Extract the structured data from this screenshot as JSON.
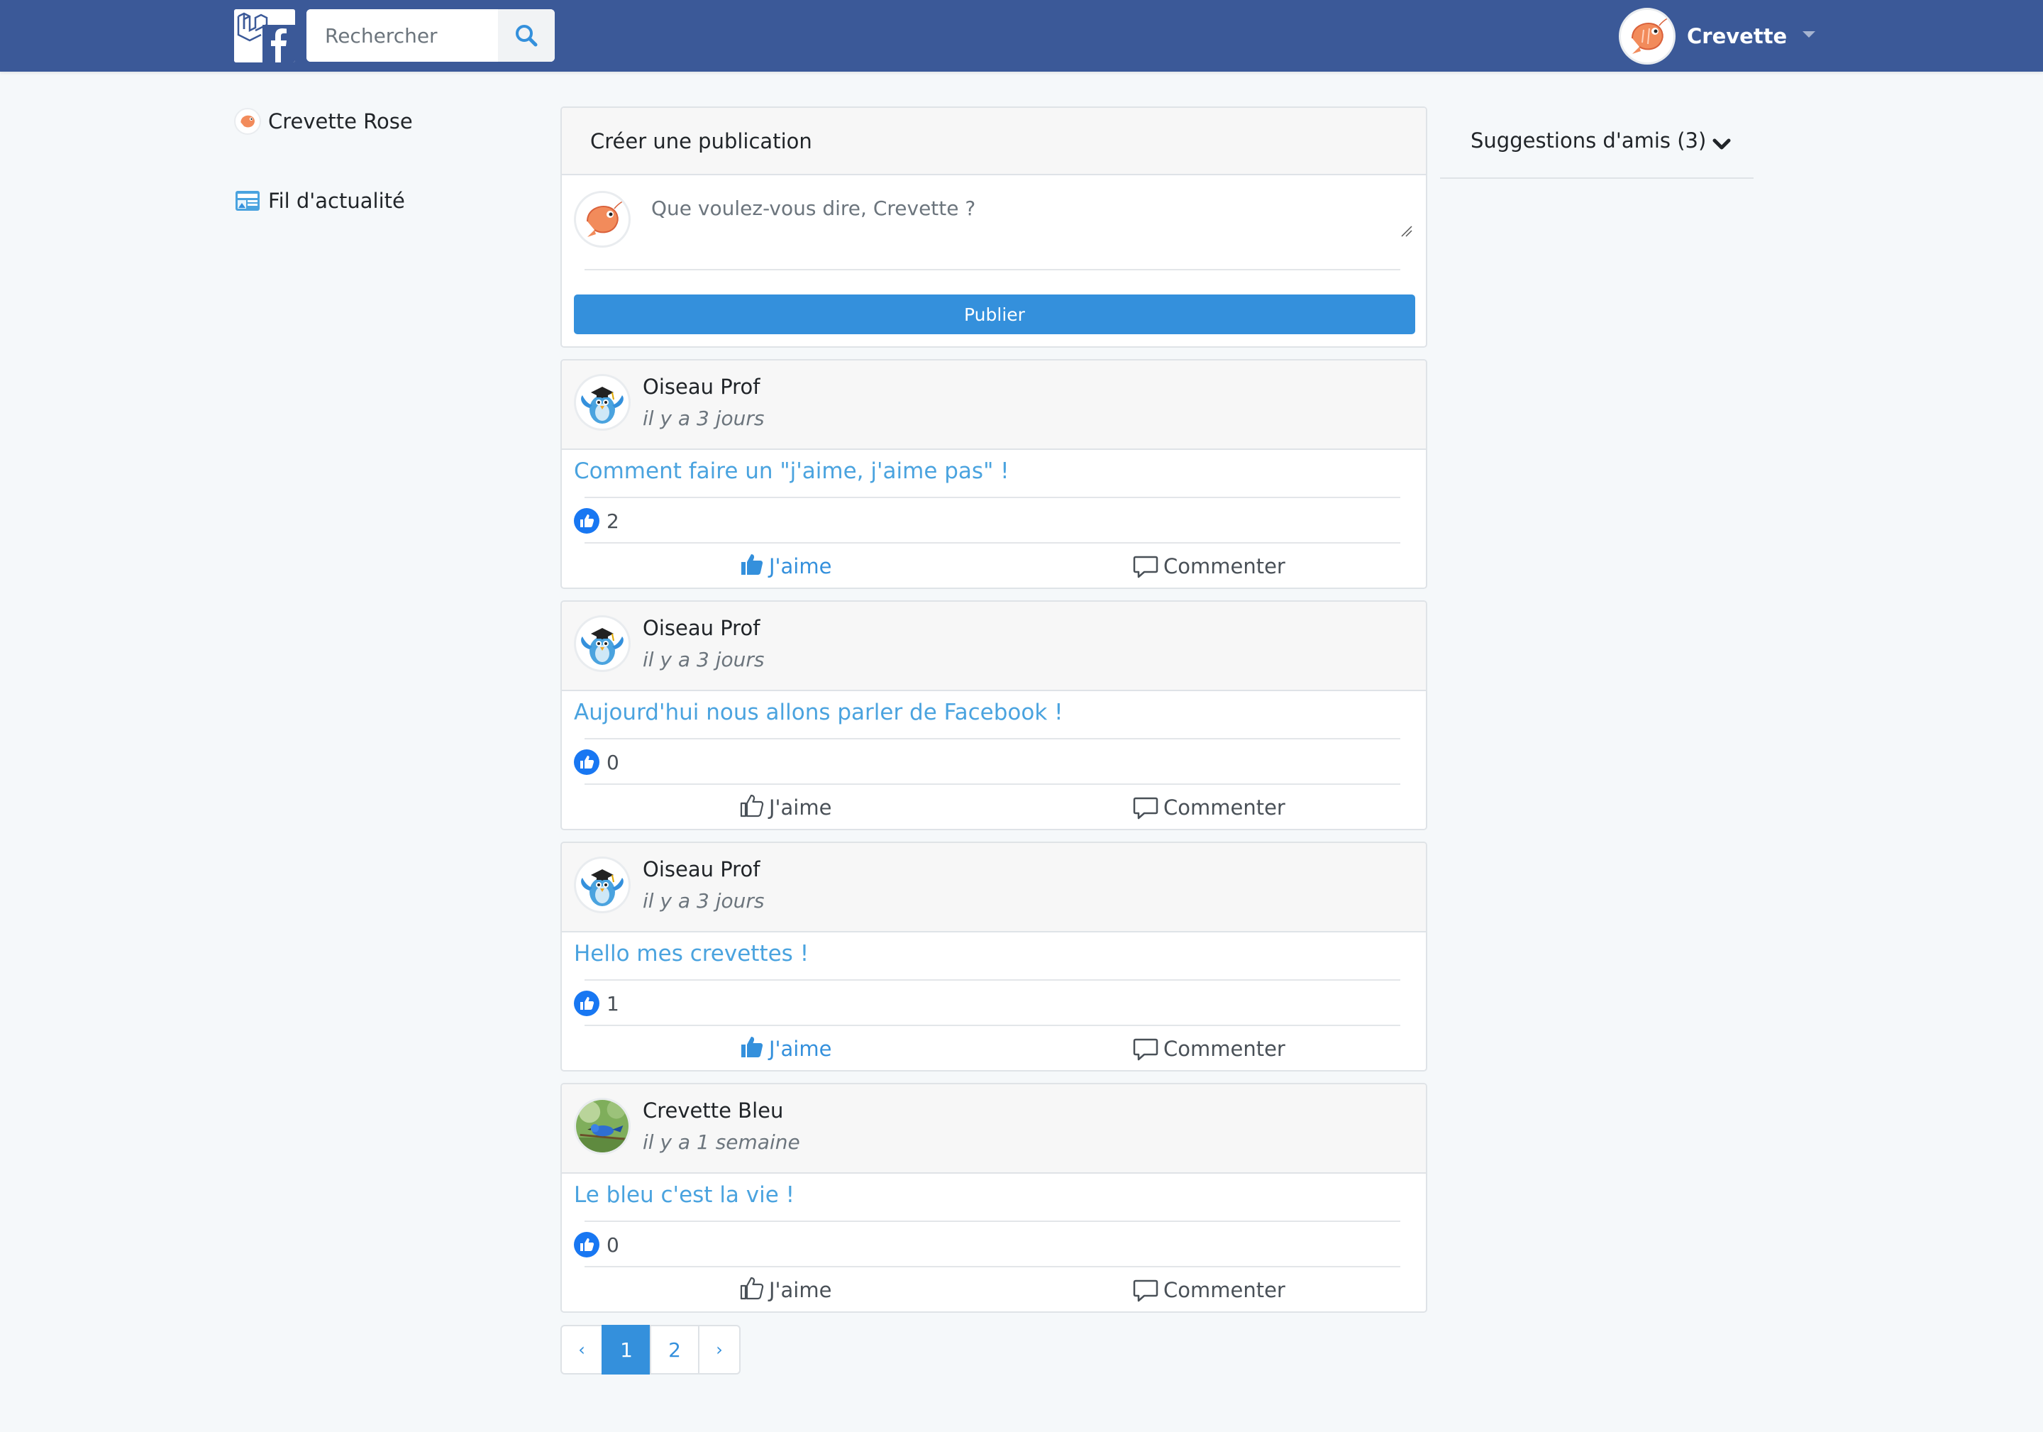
{
  "navbar": {
    "search_placeholder": "Rechercher",
    "user_name": "Crevette",
    "bg_color": "#3b5998"
  },
  "sidebar": {
    "items": [
      {
        "label": "Crevette Rose",
        "icon": "shrimp-avatar-icon"
      },
      {
        "label": "Fil d'actualité",
        "icon": "newsfeed-icon"
      }
    ]
  },
  "create_post": {
    "title": "Créer une publication",
    "placeholder": "Que voulez-vous dire, Crevette ?",
    "button": "Publier",
    "accent": "#3490dc"
  },
  "posts": [
    {
      "author": "Oiseau Prof",
      "time": "il y a 3 jours",
      "content": "Comment faire un \"j'aime, j'aime pas\" !",
      "likes": "2",
      "liked": true,
      "like_label": "J'aime",
      "comment_label": "Commenter",
      "avatar": "bird-professor-avatar"
    },
    {
      "author": "Oiseau Prof",
      "time": "il y a 3 jours",
      "content": "Aujourd'hui nous allons parler de Facebook !",
      "likes": "0",
      "liked": false,
      "like_label": "J'aime",
      "comment_label": "Commenter",
      "avatar": "bird-professor-avatar"
    },
    {
      "author": "Oiseau Prof",
      "time": "il y a 3 jours",
      "content": "Hello mes crevettes !",
      "likes": "1",
      "liked": true,
      "like_label": "J'aime",
      "comment_label": "Commenter",
      "avatar": "bird-professor-avatar"
    },
    {
      "author": "Crevette Bleu",
      "time": "il y a 1 semaine",
      "content": "Le bleu c'est la vie !",
      "likes": "0",
      "liked": false,
      "like_label": "J'aime",
      "comment_label": "Commenter",
      "avatar": "blue-bird-photo-avatar"
    }
  ],
  "pagination": {
    "prev": "‹",
    "pages": [
      "1",
      "2"
    ],
    "active": "1",
    "next": "›"
  },
  "suggestions": {
    "label": "Suggestions d'amis (3)"
  }
}
